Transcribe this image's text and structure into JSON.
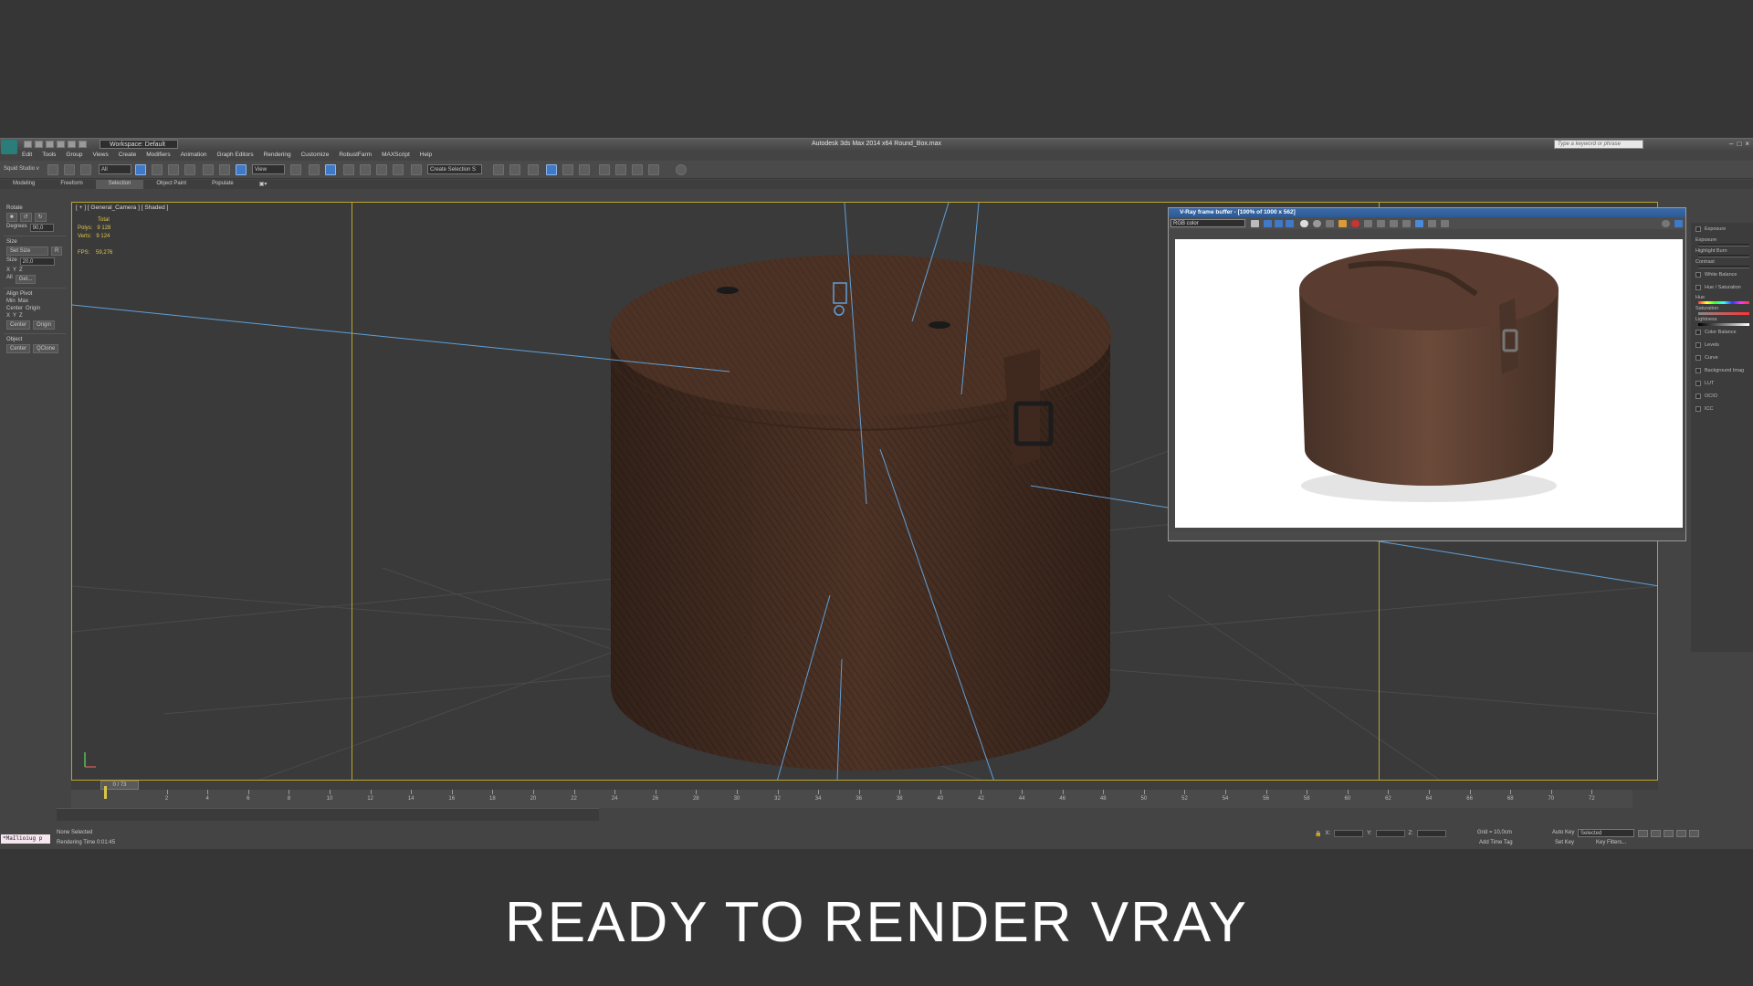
{
  "window": {
    "title": "Autodesk 3ds Max  2014 x64    Round_Box.max",
    "workspace": "Workspace: Default",
    "search_placeholder": "Type a keyword or phrase"
  },
  "menu": [
    "Edit",
    "Tools",
    "Group",
    "Views",
    "Create",
    "Modifiers",
    "Animation",
    "Graph Editors",
    "Rendering",
    "Customize",
    "RobustFarm",
    "MAXScript",
    "Help"
  ],
  "toolbar": {
    "prefix": "Squid Studio v",
    "filter": "All",
    "ref_coord": "View",
    "selection_set": "Create Selection S"
  },
  "ribbon": {
    "tabs": [
      "Modeling",
      "Freeform",
      "Selection",
      "Object Paint",
      "Populate"
    ],
    "active": "Selection"
  },
  "left_panel": {
    "rotate_title": "Rotate",
    "degrees_label": "Degrees",
    "degrees_value": "90,0",
    "size_title": "Size",
    "set_size": "Set Size",
    "r_label": "R",
    "size_label": "Size",
    "size_value": "20,0",
    "axes": [
      "X",
      "Y",
      "Z"
    ],
    "all_label": "All",
    "get_label": "Get...",
    "align_title": "Align Pivot",
    "min": "Min",
    "max": "Max",
    "center": "Center",
    "origin": "Origin",
    "x": "X",
    "y": "Y",
    "z": "Z",
    "center_btn": "Center",
    "origin_btn": "Origin",
    "object_title": "Object",
    "obj_center": "Center",
    "qclone": "QClone"
  },
  "viewport": {
    "label": "[ + ] [ General_Camera ] [ Shaded ]",
    "stats": {
      "total_label": "Total",
      "polys_label": "Polys:",
      "polys": "9 128",
      "verts_label": "Verts:",
      "verts": "9 124",
      "fps_label": "FPS:",
      "fps": "59,276"
    },
    "box_color": "#4d3326"
  },
  "vfb": {
    "title": "V-Ray frame buffer - [100% of 1000 x 562]",
    "channel": "RGB color",
    "side_items": {
      "exposure": "Exposure",
      "exposure_sub": "Exposure",
      "highlight": "Highlight Burn",
      "contrast": "Contrast",
      "white_balance": "White Balance",
      "hue_sat": "Hue / Saturation",
      "hue": "Hue",
      "saturation": "Saturation",
      "lightness": "Lightness",
      "color_balance": "Color Balance",
      "levels": "Levels",
      "curve": "Curve",
      "background": "Background Imag",
      "lut": "LUT",
      "ocio": "OCIO",
      "icc": "ICC"
    }
  },
  "timeline": {
    "frame": "0 / 73",
    "ticks": [
      "2",
      "4",
      "6",
      "8",
      "10",
      "12",
      "14",
      "16",
      "18",
      "20",
      "22",
      "24",
      "26",
      "28",
      "30",
      "32",
      "34",
      "36",
      "38",
      "40",
      "42",
      "44",
      "46",
      "48",
      "50",
      "52",
      "54",
      "56",
      "58",
      "60",
      "62",
      "64",
      "66",
      "68",
      "70",
      "72"
    ]
  },
  "status": {
    "maxscript": "*MaIlioiug p",
    "selected": "None Selected",
    "render_time": "Rendering Time  0:01:45",
    "x": "X:",
    "y": "Y:",
    "z": "Z:",
    "grid": "Grid = 10,0cm",
    "add_tag": "Add Time Tag",
    "auto_key": "Auto Key",
    "set_key": "Set Key",
    "selected_set": "Selected",
    "key_filters": "Key Filters..."
  },
  "caption": "READY TO RENDER VRAY"
}
